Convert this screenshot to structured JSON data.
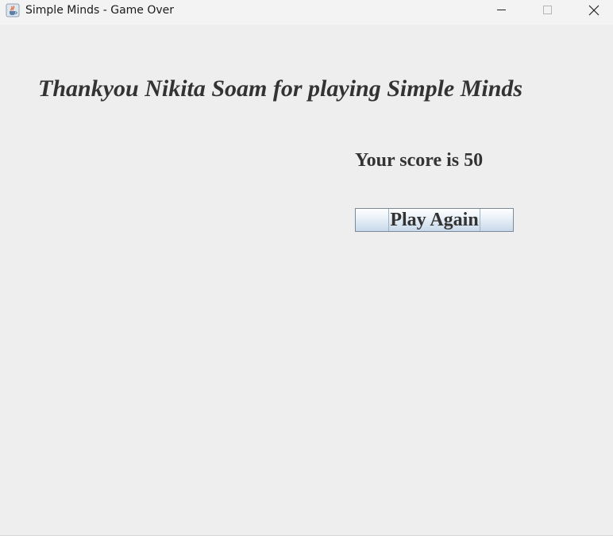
{
  "window": {
    "title": "Simple Minds - Game Over",
    "app_icon": "java-cup-icon",
    "controls": {
      "minimize_icon": "minimize-icon",
      "maximize_icon": "maximize-icon",
      "close_icon": "close-icon"
    }
  },
  "main": {
    "thank_you_message": "Thankyou Nikita Soam for playing Simple Minds",
    "score_text": "Your score is 50",
    "play_again_label": "Play Again"
  },
  "colors": {
    "background": "#eeeeee",
    "text": "#333333",
    "button_border": "#7a8a99"
  }
}
